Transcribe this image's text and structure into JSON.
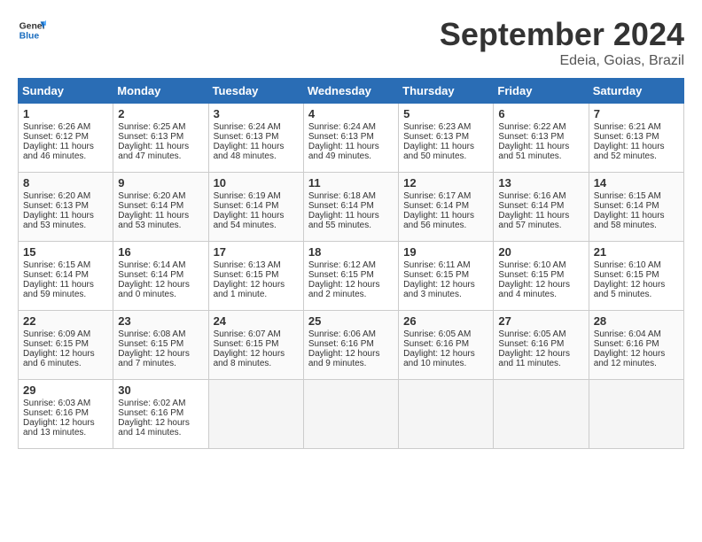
{
  "logo": {
    "line1": "General",
    "line2": "Blue"
  },
  "title": "September 2024",
  "subtitle": "Edeia, Goias, Brazil",
  "days_of_week": [
    "Sunday",
    "Monday",
    "Tuesday",
    "Wednesday",
    "Thursday",
    "Friday",
    "Saturday"
  ],
  "weeks": [
    [
      {
        "num": "1",
        "sunrise": "6:26 AM",
        "sunset": "6:12 PM",
        "daylight": "11 hours and 46 minutes."
      },
      {
        "num": "2",
        "sunrise": "6:25 AM",
        "sunset": "6:13 PM",
        "daylight": "11 hours and 47 minutes."
      },
      {
        "num": "3",
        "sunrise": "6:24 AM",
        "sunset": "6:13 PM",
        "daylight": "11 hours and 48 minutes."
      },
      {
        "num": "4",
        "sunrise": "6:24 AM",
        "sunset": "6:13 PM",
        "daylight": "11 hours and 49 minutes."
      },
      {
        "num": "5",
        "sunrise": "6:23 AM",
        "sunset": "6:13 PM",
        "daylight": "11 hours and 50 minutes."
      },
      {
        "num": "6",
        "sunrise": "6:22 AM",
        "sunset": "6:13 PM",
        "daylight": "11 hours and 51 minutes."
      },
      {
        "num": "7",
        "sunrise": "6:21 AM",
        "sunset": "6:13 PM",
        "daylight": "11 hours and 52 minutes."
      }
    ],
    [
      {
        "num": "8",
        "sunrise": "6:20 AM",
        "sunset": "6:13 PM",
        "daylight": "11 hours and 53 minutes."
      },
      {
        "num": "9",
        "sunrise": "6:20 AM",
        "sunset": "6:14 PM",
        "daylight": "11 hours and 53 minutes."
      },
      {
        "num": "10",
        "sunrise": "6:19 AM",
        "sunset": "6:14 PM",
        "daylight": "11 hours and 54 minutes."
      },
      {
        "num": "11",
        "sunrise": "6:18 AM",
        "sunset": "6:14 PM",
        "daylight": "11 hours and 55 minutes."
      },
      {
        "num": "12",
        "sunrise": "6:17 AM",
        "sunset": "6:14 PM",
        "daylight": "11 hours and 56 minutes."
      },
      {
        "num": "13",
        "sunrise": "6:16 AM",
        "sunset": "6:14 PM",
        "daylight": "11 hours and 57 minutes."
      },
      {
        "num": "14",
        "sunrise": "6:15 AM",
        "sunset": "6:14 PM",
        "daylight": "11 hours and 58 minutes."
      }
    ],
    [
      {
        "num": "15",
        "sunrise": "6:15 AM",
        "sunset": "6:14 PM",
        "daylight": "11 hours and 59 minutes."
      },
      {
        "num": "16",
        "sunrise": "6:14 AM",
        "sunset": "6:14 PM",
        "daylight": "12 hours and 0 minutes."
      },
      {
        "num": "17",
        "sunrise": "6:13 AM",
        "sunset": "6:15 PM",
        "daylight": "12 hours and 1 minute."
      },
      {
        "num": "18",
        "sunrise": "6:12 AM",
        "sunset": "6:15 PM",
        "daylight": "12 hours and 2 minutes."
      },
      {
        "num": "19",
        "sunrise": "6:11 AM",
        "sunset": "6:15 PM",
        "daylight": "12 hours and 3 minutes."
      },
      {
        "num": "20",
        "sunrise": "6:10 AM",
        "sunset": "6:15 PM",
        "daylight": "12 hours and 4 minutes."
      },
      {
        "num": "21",
        "sunrise": "6:10 AM",
        "sunset": "6:15 PM",
        "daylight": "12 hours and 5 minutes."
      }
    ],
    [
      {
        "num": "22",
        "sunrise": "6:09 AM",
        "sunset": "6:15 PM",
        "daylight": "12 hours and 6 minutes."
      },
      {
        "num": "23",
        "sunrise": "6:08 AM",
        "sunset": "6:15 PM",
        "daylight": "12 hours and 7 minutes."
      },
      {
        "num": "24",
        "sunrise": "6:07 AM",
        "sunset": "6:15 PM",
        "daylight": "12 hours and 8 minutes."
      },
      {
        "num": "25",
        "sunrise": "6:06 AM",
        "sunset": "6:16 PM",
        "daylight": "12 hours and 9 minutes."
      },
      {
        "num": "26",
        "sunrise": "6:05 AM",
        "sunset": "6:16 PM",
        "daylight": "12 hours and 10 minutes."
      },
      {
        "num": "27",
        "sunrise": "6:05 AM",
        "sunset": "6:16 PM",
        "daylight": "12 hours and 11 minutes."
      },
      {
        "num": "28",
        "sunrise": "6:04 AM",
        "sunset": "6:16 PM",
        "daylight": "12 hours and 12 minutes."
      }
    ],
    [
      {
        "num": "29",
        "sunrise": "6:03 AM",
        "sunset": "6:16 PM",
        "daylight": "12 hours and 13 minutes."
      },
      {
        "num": "30",
        "sunrise": "6:02 AM",
        "sunset": "6:16 PM",
        "daylight": "12 hours and 14 minutes."
      },
      null,
      null,
      null,
      null,
      null
    ]
  ]
}
